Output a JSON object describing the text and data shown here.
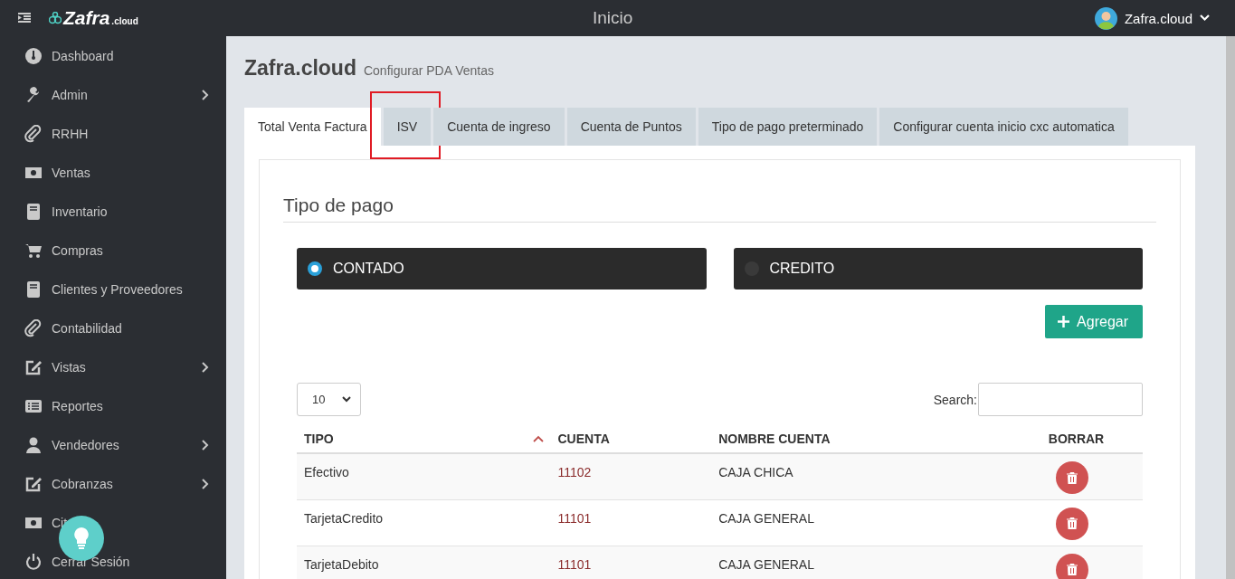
{
  "header": {
    "logo": "Zafra",
    "logo_suffix": ".cloud",
    "title": "Inicio",
    "user": "Zafra.cloud"
  },
  "sidebar": {
    "items": [
      {
        "label": "Dashboard",
        "kind": "gauge",
        "submenu": false
      },
      {
        "label": "Admin",
        "kind": "wrench",
        "submenu": true
      },
      {
        "label": "RRHH",
        "kind": "paperclip",
        "submenu": false
      },
      {
        "label": "Ventas",
        "kind": "money",
        "submenu": false
      },
      {
        "label": "Inventario",
        "kind": "book",
        "submenu": false
      },
      {
        "label": "Compras",
        "kind": "cart",
        "submenu": false
      },
      {
        "label": "Clientes y Proveedores",
        "kind": "book",
        "submenu": false
      },
      {
        "label": "Contabilidad",
        "kind": "paperclip",
        "submenu": false
      },
      {
        "label": "Vistas",
        "kind": "edit",
        "submenu": true
      },
      {
        "label": "Reportes",
        "kind": "list",
        "submenu": false
      },
      {
        "label": "Vendedores",
        "kind": "user",
        "submenu": true
      },
      {
        "label": "Cobranzas",
        "kind": "edit",
        "submenu": true
      },
      {
        "label": "Cit",
        "kind": "money",
        "submenu": false
      },
      {
        "label": "Cerrar Sesión",
        "kind": "power",
        "submenu": false
      }
    ]
  },
  "page": {
    "brand": "Zafra.cloud",
    "subtitle": "Configurar PDA Ventas"
  },
  "tabs": [
    {
      "label": "Total Venta Factura",
      "selected": true,
      "annotated": false
    },
    {
      "label": "ISV",
      "selected": false,
      "annotated": true
    },
    {
      "label": "Cuenta de ingreso",
      "selected": false,
      "annotated": false
    },
    {
      "label": "Cuenta de Puntos",
      "selected": false,
      "annotated": false
    },
    {
      "label": "Tipo de pago preterminado",
      "selected": false,
      "annotated": false
    },
    {
      "label": "Configurar cuenta inicio cxc automatica",
      "selected": false,
      "annotated": false
    }
  ],
  "section_title": "Tipo de pago",
  "payment_options": [
    {
      "label": "CONTADO",
      "selected": true
    },
    {
      "label": "CREDITO",
      "selected": false
    }
  ],
  "add_button": "Agregar",
  "table": {
    "page_size": "10",
    "search_label": "Search:",
    "columns": [
      {
        "label": "TIPO",
        "sorted": true
      },
      {
        "label": "CUENTA",
        "sorted": false
      },
      {
        "label": "NOMBRE CUENTA",
        "sorted": false
      },
      {
        "label": "BORRAR",
        "sorted": false
      }
    ],
    "rows": [
      {
        "tipo": "Efectivo",
        "cuenta": "11102",
        "nombre": "CAJA CHICA"
      },
      {
        "tipo": "TarjetaCredito",
        "cuenta": "11101",
        "nombre": "CAJA GENERAL"
      },
      {
        "tipo": "TarjetaDebito",
        "cuenta": "11101",
        "nombre": "CAJA GENERAL"
      }
    ]
  }
}
